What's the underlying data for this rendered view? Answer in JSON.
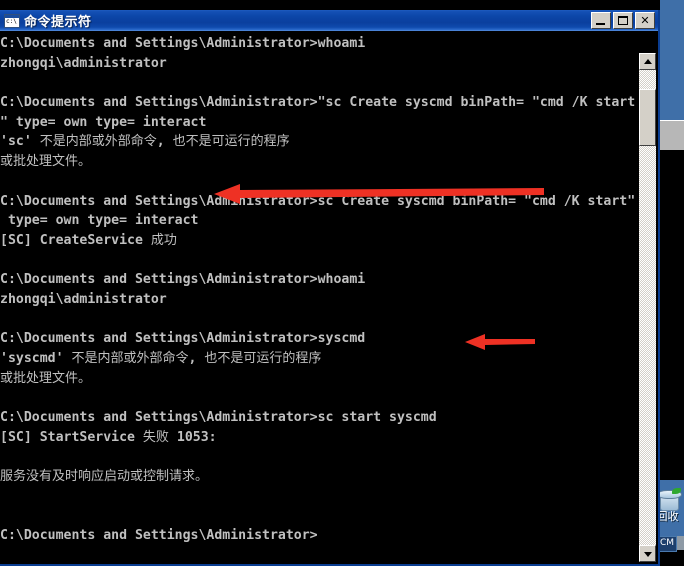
{
  "window": {
    "title": "命令提示符",
    "icon": "console-icon",
    "buttons": {
      "minimize": "_",
      "maximize": "❐",
      "close": "✕"
    }
  },
  "desktop": {
    "background_color": "#3f6fa8",
    "recycle_bin": {
      "label": "回收",
      "icon": "recycle-bin-icon"
    },
    "taskbar": {
      "button_label": "CM"
    }
  },
  "scrollbar": {
    "up_arrow": "scroll-up-icon",
    "down_arrow": "scroll-down-icon",
    "thumb": "scroll-thumb"
  },
  "console": {
    "foreground_color": "#c0c0c0",
    "background_color": "#000000",
    "lines": [
      "C:\\Documents and Settings\\Administrator>whoami",
      "zhongqi\\administrator",
      "",
      "C:\\Documents and Settings\\Administrator>\"sc Create syscmd binPath= \"cmd /K start",
      "\" type= own type= interact",
      "'sc' 不是内部或外部命令, 也不是可运行的程序",
      "或批处理文件。",
      "",
      "C:\\Documents and Settings\\Administrator>sc Create syscmd binPath= \"cmd /K start\"",
      " type= own type= interact",
      "[SC] CreateService 成功",
      "",
      "C:\\Documents and Settings\\Administrator>whoami",
      "zhongqi\\administrator",
      "",
      "C:\\Documents and Settings\\Administrator>syscmd",
      "'syscmd' 不是内部或外部命令, 也不是可运行的程序",
      "或批处理文件。",
      "",
      "C:\\Documents and Settings\\Administrator>sc start syscmd",
      "[SC] StartService 失败 1053:",
      "",
      "服务没有及时响应启动或控制请求。",
      "",
      "",
      "C:\\Documents and Settings\\Administrator>"
    ]
  },
  "annotations": {
    "color": "#ee3124",
    "arrows": [
      {
        "name": "arrow-createservice-success",
        "points_at": "[SC] CreateService 成功"
      },
      {
        "name": "arrow-sc-start-syscmd",
        "points_at": "sc start syscmd"
      }
    ]
  }
}
